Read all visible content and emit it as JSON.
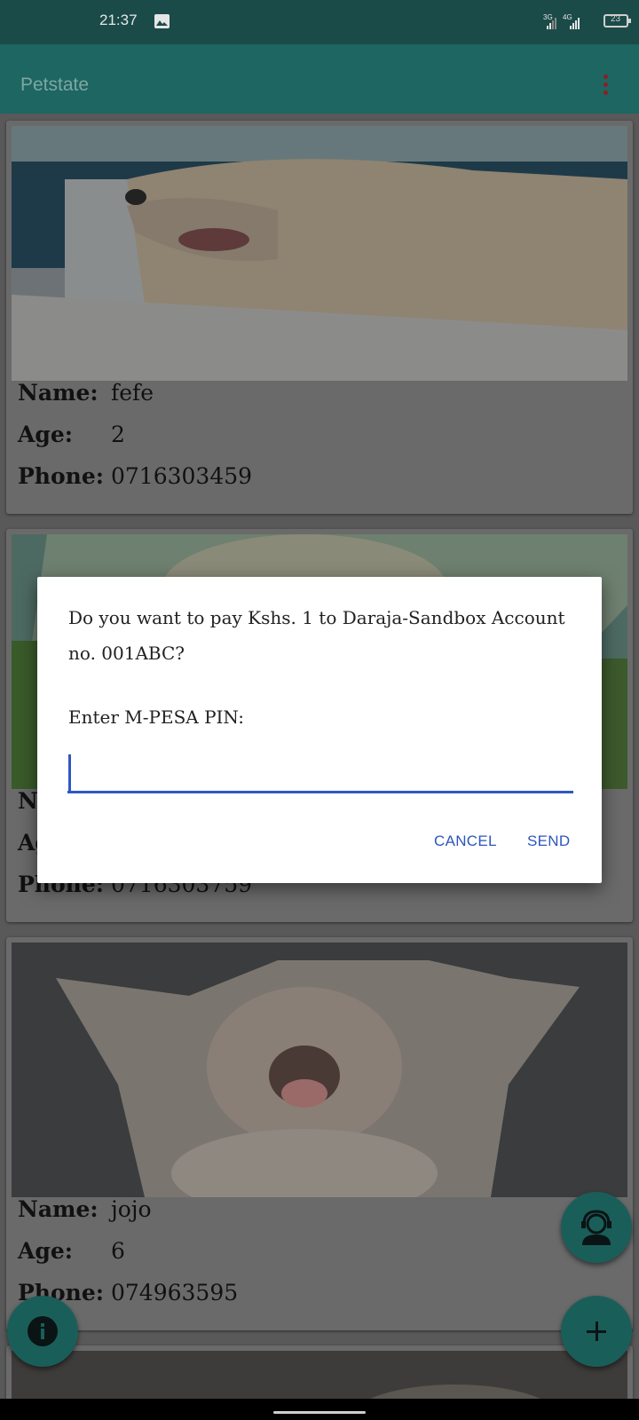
{
  "status_bar": {
    "time": "21:37",
    "network_1": "3G",
    "network_2": "4G",
    "battery_level": "23",
    "icons": [
      "image-icon",
      "signal-icon",
      "battery-icon"
    ]
  },
  "app_bar": {
    "title": "Petstate",
    "menu_icon": "more-vert-icon"
  },
  "cards": [
    {
      "photo": "dog-photo",
      "name_label": "Name:",
      "name": "fefe",
      "age_label": "Age:",
      "age": "2",
      "phone_label": "Phone:",
      "phone": "0716303459"
    },
    {
      "photo": "dog-photo",
      "name_label": "Na",
      "age_label": "Ag",
      "phone_label": "Phone:",
      "phone": "0716303759"
    },
    {
      "photo": "cat-photo",
      "name_label": "Name:",
      "name": "jojo",
      "age_label": "Age:",
      "age": "6",
      "phone_label": "Phone:",
      "phone": "074963595"
    }
  ],
  "dialog": {
    "message": "Do you want to pay Kshs. 1 to Daraja-Sandbox Account no. 001ABC?",
    "pin_label": "Enter M-PESA PIN:",
    "pin_value": "",
    "cancel_label": "CANCEL",
    "send_label": "SEND"
  },
  "fabs": {
    "support_icon": "support-agent-icon",
    "add_icon": "plus-icon",
    "info_icon": "info-icon"
  },
  "colors": {
    "status_bar": "#1b4b48",
    "app_bar": "#1d6662",
    "accent": "#2f57c4",
    "fab": "#1a5e5a"
  }
}
